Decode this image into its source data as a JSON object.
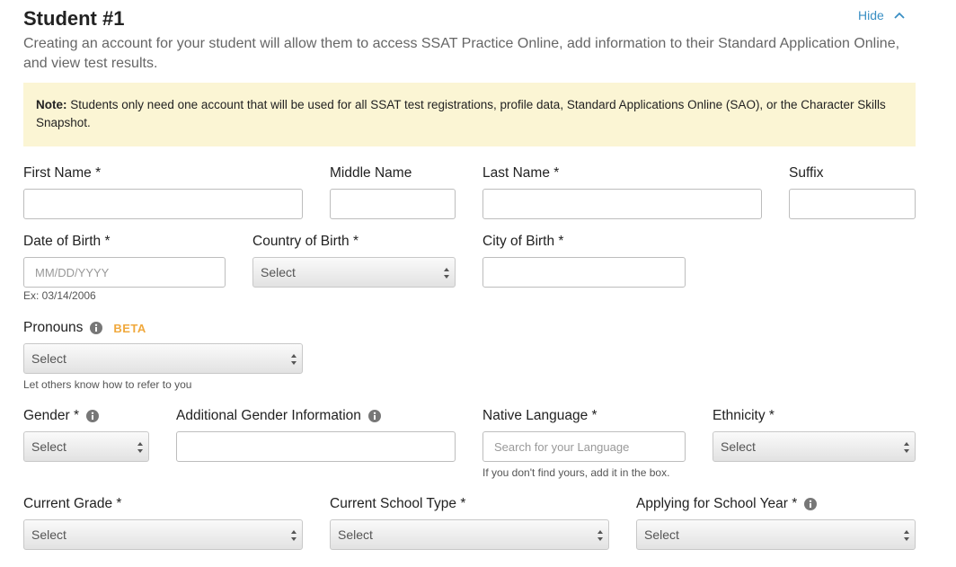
{
  "header": {
    "title": "Student #1",
    "hide_label": "Hide",
    "intro": "Creating an account for your student will allow them to access SSAT Practice Online, add information to their Standard Application Online, and view test results."
  },
  "note": {
    "bold": "Note:",
    "text": " Students only need one account that will be used for all SSAT test registrations, profile data, Standard Applications Online (SAO), or the Character Skills Snapshot."
  },
  "fields": {
    "first_name": {
      "label": "First Name *",
      "value": ""
    },
    "middle_name": {
      "label": "Middle Name",
      "value": ""
    },
    "last_name": {
      "label": "Last Name *",
      "value": ""
    },
    "suffix": {
      "label": "Suffix",
      "value": ""
    },
    "dob": {
      "label": "Date of Birth *",
      "placeholder": "MM/DD/YYYY",
      "help": "Ex: 03/14/2006"
    },
    "country_of_birth": {
      "label": "Country of Birth *",
      "selected": "Select"
    },
    "city_of_birth": {
      "label": "City of Birth *",
      "value": ""
    },
    "pronouns": {
      "label": "Pronouns",
      "badge": "BETA",
      "selected": "Select",
      "help": "Let others know how to refer to you"
    },
    "gender": {
      "label": "Gender *",
      "selected": "Select"
    },
    "additional_gender": {
      "label": "Additional Gender Information",
      "value": ""
    },
    "native_language": {
      "label": "Native Language *",
      "placeholder": "Search for your Language",
      "help": "If you don't find yours, add it in the box."
    },
    "ethnicity": {
      "label": "Ethnicity *",
      "selected": "Select"
    },
    "current_grade": {
      "label": "Current Grade *",
      "selected": "Select"
    },
    "current_school_type": {
      "label": "Current School Type *",
      "selected": "Select"
    },
    "applying_year": {
      "label": "Applying for School Year *",
      "selected": "Select"
    }
  },
  "colors": {
    "link": "#3a8fc4",
    "note_bg": "#fbf5d4",
    "beta": "#f0a83c"
  }
}
